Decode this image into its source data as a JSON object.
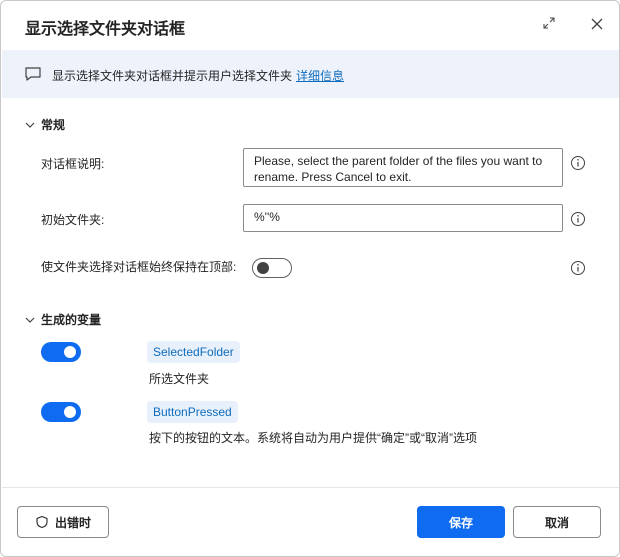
{
  "dialog": {
    "title": "显示选择文件夹对话框"
  },
  "info": {
    "text": "显示选择文件夹对话框并提示用户选择文件夹",
    "link": "详细信息"
  },
  "general": {
    "header": "常规",
    "dialog_description_label": "对话框说明:",
    "dialog_description_value": "Please, select the parent folder of the files you want to rename. Press Cancel to exit.",
    "initial_folder_label": "初始文件夹:",
    "initial_folder_value": "%''%",
    "keep_on_top_label": "使文件夹选择对话框始终保持在顶部:",
    "keep_on_top_enabled": false
  },
  "variables": {
    "header": "生成的变量",
    "items": [
      {
        "name": "SelectedFolder",
        "description": "所选文件夹",
        "enabled": true
      },
      {
        "name": "ButtonPressed",
        "description": "按下的按钮的文本。系统将自动为用户提供“确定”或“取消”选项",
        "enabled": true
      }
    ]
  },
  "footer": {
    "on_error_label": "出错时",
    "save_label": "保存",
    "cancel_label": "取消"
  },
  "colors": {
    "accent": "#0f6cf0",
    "link": "#0f6cbd",
    "info_bar": "#eef3fb",
    "pill_bg": "#e8f0fc"
  },
  "icons": [
    "expand-icon",
    "close-icon",
    "message-icon",
    "chevron-down-icon",
    "info-circle-icon",
    "shield-icon"
  ]
}
